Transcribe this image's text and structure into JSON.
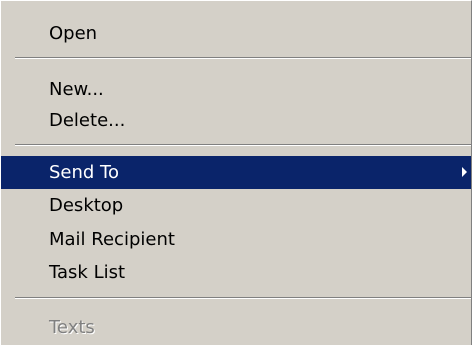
{
  "menu": {
    "items": [
      {
        "label": "Open"
      },
      {
        "label": "New..."
      },
      {
        "label": "Delete..."
      },
      {
        "label": "Send To",
        "selected": true,
        "has_submenu": true
      },
      {
        "label": "Desktop"
      },
      {
        "label": "Mail Recipient"
      },
      {
        "label": "Task List"
      },
      {
        "label": "Texts",
        "disabled": true
      }
    ]
  },
  "colors": {
    "menu_background": "#d4d0c8",
    "highlight_background": "#0a246a",
    "highlight_text": "#ffffff",
    "disabled_text": "#808080"
  },
  "icons": {
    "submenu_arrow": "triangle-right"
  }
}
